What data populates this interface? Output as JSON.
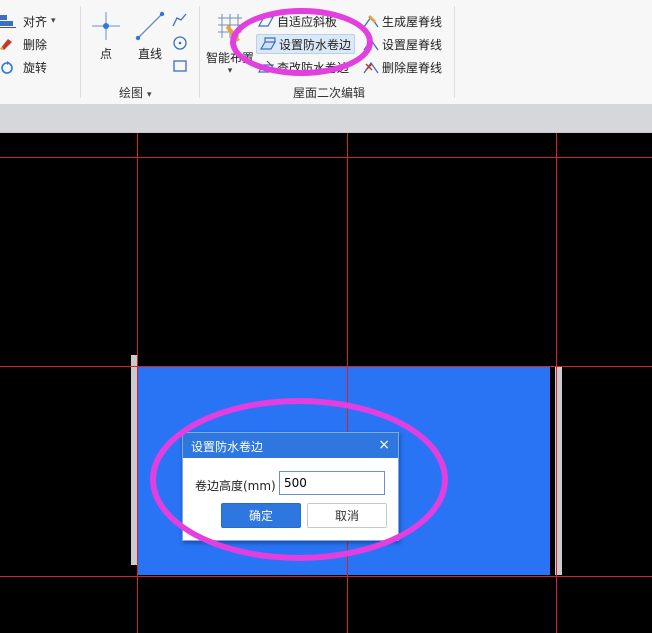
{
  "ribbon": {
    "modify_group": {
      "align": "对齐",
      "delete": "删除",
      "rotate": "旋转"
    },
    "draw_group": {
      "label": "绘图",
      "point": "点",
      "line": "直线"
    },
    "roof_group": {
      "label": "屋面二次编辑",
      "smart_layout": "智能布置",
      "adaptive_slope": "自适应斜板",
      "set_waterproof_edge": "设置防水卷边",
      "edit_waterproof_edge": "查改防水卷边",
      "gen_ridge": "生成屋脊线",
      "set_ridge": "设置屋脊线",
      "delete_ridge": "删除屋脊线"
    }
  },
  "dialog": {
    "title": "设置防水卷边",
    "close": "×",
    "height_label": "卷边高度(mm)",
    "height_value": "500",
    "ok": "确定",
    "cancel": "取消"
  },
  "colors": {
    "grid_line": "#d2222a",
    "roof_fill": "#2874f5",
    "dialog_accent": "#2d77de",
    "highlight": "#e33ee0"
  }
}
